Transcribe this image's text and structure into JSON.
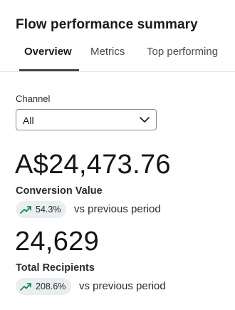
{
  "header": {
    "title": "Flow performance summary"
  },
  "tabs": [
    {
      "label": "Overview",
      "active": true
    },
    {
      "label": "Metrics",
      "active": false
    },
    {
      "label": "Top performing",
      "active": false
    }
  ],
  "filter": {
    "label": "Channel",
    "value": "All"
  },
  "metrics": [
    {
      "value": "A$24,473.76",
      "label": "Conversion Value",
      "change": "54.3%",
      "comparison": "vs previous period",
      "trend": "up"
    },
    {
      "value": "24,629",
      "label": "Total Recipients",
      "change": "208.6%",
      "comparison": "vs previous period",
      "trend": "up"
    }
  ],
  "colors": {
    "trend_up": "#1f8a4c",
    "badge_bg": "#e9eef0",
    "tab_underline": "#4a4a4a"
  }
}
